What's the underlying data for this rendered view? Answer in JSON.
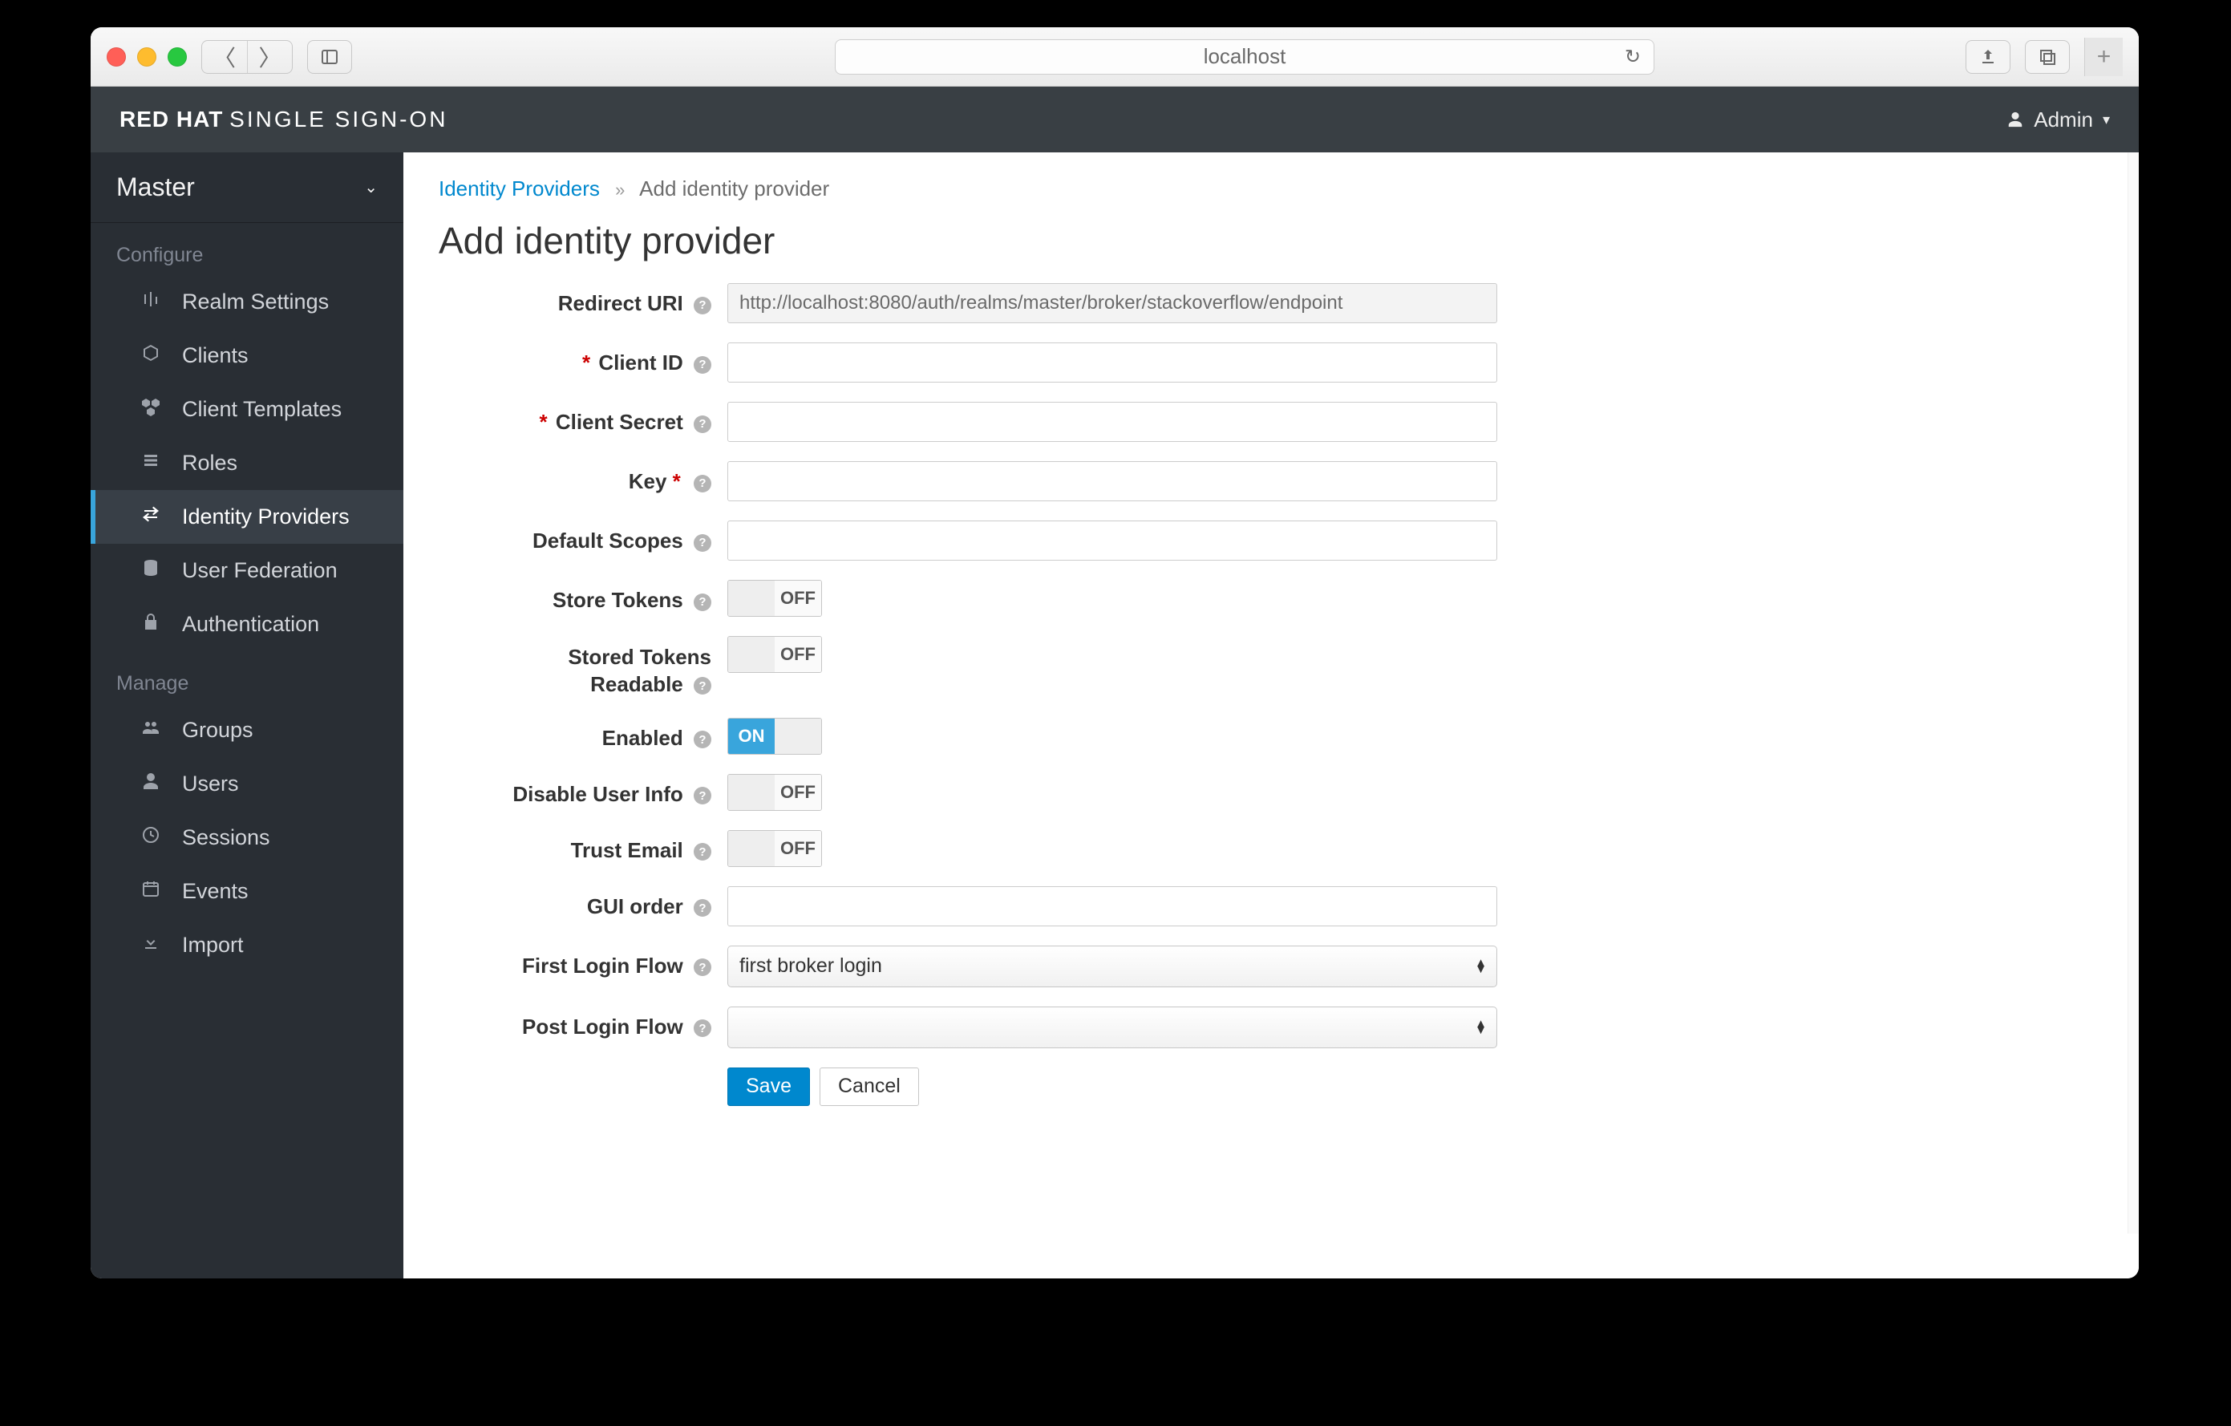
{
  "browser": {
    "address": "localhost"
  },
  "header": {
    "brand_bold": "RED HAT",
    "brand_thin": "SINGLE SIGN-ON",
    "user_label": "Admin"
  },
  "sidebar": {
    "realm": "Master",
    "configure_label": "Configure",
    "manage_label": "Manage",
    "configure": {
      "realm_settings": "Realm Settings",
      "clients": "Clients",
      "client_templates": "Client Templates",
      "roles": "Roles",
      "identity_providers": "Identity Providers",
      "user_federation": "User Federation",
      "authentication": "Authentication"
    },
    "manage": {
      "groups": "Groups",
      "users": "Users",
      "sessions": "Sessions",
      "events": "Events",
      "import": "Import"
    }
  },
  "breadcrumb": {
    "root": "Identity Providers",
    "current": "Add identity provider"
  },
  "page": {
    "title": "Add identity provider"
  },
  "form": {
    "redirect_uri_label": "Redirect URI",
    "redirect_uri_value": "http://localhost:8080/auth/realms/master/broker/stackoverflow/endpoint",
    "client_id_label": "Client ID",
    "client_id_value": "",
    "client_secret_label": "Client Secret",
    "client_secret_value": "",
    "key_label": "Key",
    "key_value": "",
    "default_scopes_label": "Default Scopes",
    "default_scopes_value": "",
    "store_tokens_label": "Store Tokens",
    "stored_tokens_readable_label_line1": "Stored Tokens",
    "stored_tokens_readable_label_line2": "Readable",
    "enabled_label": "Enabled",
    "disable_user_info_label": "Disable User Info",
    "trust_email_label": "Trust Email",
    "gui_order_label": "GUI order",
    "gui_order_value": "",
    "first_login_flow_label": "First Login Flow",
    "first_login_flow_value": "first broker login",
    "post_login_flow_label": "Post Login Flow",
    "post_login_flow_value": "",
    "toggle_on": "ON",
    "toggle_off": "OFF",
    "save": "Save",
    "cancel": "Cancel"
  }
}
